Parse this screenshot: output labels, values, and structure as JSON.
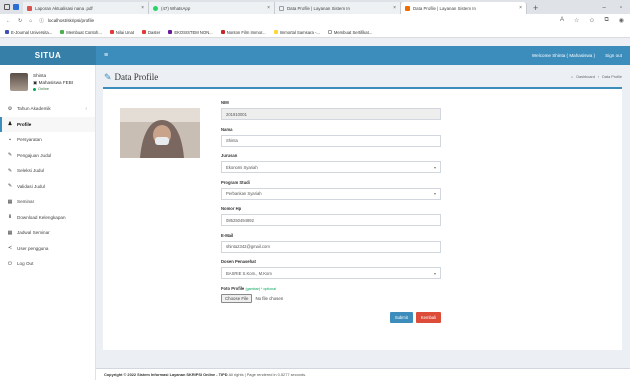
{
  "browser": {
    "tabs": [
      {
        "title": "Laporan Aktualisasi nana .pdf",
        "color": "#d9534f",
        "active": false
      },
      {
        "title": "(47) WhatsApp",
        "color": "#25d366",
        "active": false
      },
      {
        "title": "Data Profile | Layanan Sistem In",
        "color": "#9aa0a6",
        "active": false
      },
      {
        "title": "Data Profile | Layanan Sistem In",
        "color": "#ef6c00",
        "active": true
      }
    ],
    "new_tab": "+",
    "url": "localhost/skripsi/profile",
    "bookmarks": [
      {
        "label": "E-Journal Universita...",
        "color": "#3f51b5"
      },
      {
        "label": "Membuat Contoh...",
        "color": "#4caf50"
      },
      {
        "label": "Nilai Unat",
        "color": "#e53935"
      },
      {
        "label": "Daster",
        "color": "#e53935"
      },
      {
        "label": "EKOSISTEM NON...",
        "color": "#6a1b9a"
      },
      {
        "label": "Nonton Film Immor...",
        "color": "#c62828"
      },
      {
        "label": "Immortal Samsara -...",
        "color": "#fdd835"
      },
      {
        "label": "Membuat Sertifikat...",
        "color": "#9e9e9e"
      }
    ]
  },
  "app": {
    "brand": "SITUA",
    "welcome": "Welcome Shinta ( Mahasiswa )",
    "signout": "Sign out"
  },
  "user": {
    "name": "Shinta",
    "role": "Mahasiswa FEBI",
    "status": "Online"
  },
  "menu": [
    {
      "label": "Tahun Akademik",
      "icon": "⚙",
      "arrow": "‹",
      "active": false
    },
    {
      "label": "Profile",
      "icon": "♟",
      "arrow": "",
      "active": true
    },
    {
      "label": "Persyaratan",
      "icon": "▪",
      "arrow": "",
      "active": false
    },
    {
      "label": "Pengajuan Judul",
      "icon": "✎",
      "arrow": "",
      "active": false
    },
    {
      "label": "Seleksi Judul",
      "icon": "✎",
      "arrow": "",
      "active": false
    },
    {
      "label": "Validasi Judul",
      "icon": "✎",
      "arrow": "",
      "active": false
    },
    {
      "label": "Seminar",
      "icon": "▦",
      "arrow": "",
      "active": false
    },
    {
      "label": "Download Kelengkapan",
      "icon": "⬇",
      "arrow": "",
      "active": false
    },
    {
      "label": "Jadwal Seminar",
      "icon": "▦",
      "arrow": "",
      "active": false
    },
    {
      "label": "User pengguna",
      "icon": "≺",
      "arrow": "",
      "active": false
    },
    {
      "label": "Log Out",
      "icon": "⏻",
      "arrow": "",
      "active": false
    }
  ],
  "page": {
    "title": "Data Profile",
    "breadcrumb": [
      "Dashboard",
      "Data Profile"
    ]
  },
  "form": {
    "nim_label": "NIM",
    "nim": "201910001",
    "nama_label": "Nama",
    "nama": "Shinta",
    "jurusan_label": "Jurusan",
    "jurusan": "Ekonomi Syariah",
    "prodi_label": "Program Studi",
    "prodi": "Perbankan Syariah",
    "hp_label": "Nomor Hp",
    "hp": "085250494892",
    "email_label": "E-Mail",
    "email": "shinta2342@gmail.com",
    "dosen_label": "Dosen Penasehat",
    "dosen": "BASRIE S.Kom., M.Kom",
    "foto_label": "Foto Profile",
    "foto_hint": "(gambar) * optional",
    "choose_file": "Choose File",
    "no_file": "No file chosen",
    "submit": "Submit",
    "kembali": "Kembali"
  },
  "footer": {
    "copyright": "Copyright © 2022 Sistem Informasi Layanan SKRIPSI Online - TIPD",
    "rights": "All rights | Page rendered in 0.5277 seconds."
  }
}
